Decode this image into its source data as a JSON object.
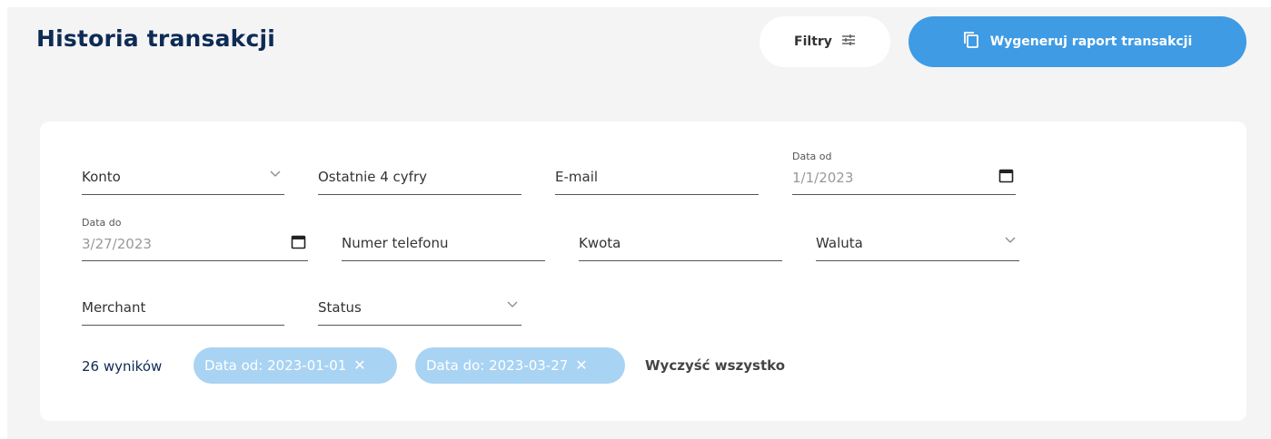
{
  "header": {
    "title": "Historia transakcji",
    "filters_label": "Filtry",
    "report_label": "Wygeneruj raport transakcji"
  },
  "filters": {
    "konto": {
      "label": "Konto"
    },
    "last4": {
      "label": "Ostatnie 4 cyfry"
    },
    "email": {
      "label": "E-mail"
    },
    "date_from": {
      "label": "Data od",
      "value": "1/1/2023"
    },
    "date_to": {
      "label": "Data do",
      "value": "3/27/2023"
    },
    "phone": {
      "label": "Numer telefonu"
    },
    "amount": {
      "label": "Kwota"
    },
    "currency": {
      "label": "Waluta"
    },
    "merchant": {
      "label": "Merchant"
    },
    "status": {
      "label": "Status"
    }
  },
  "summary": {
    "results": "26 wyników",
    "chips": [
      {
        "label": "Data od: 2023-01-01"
      },
      {
        "label": "Data do: 2023-03-27"
      }
    ],
    "clear_all": "Wyczyść wszystko"
  },
  "colors": {
    "accent": "#3f9be4",
    "chip": "#a9d3f3",
    "title": "#0d2b55"
  },
  "icons": {
    "filters": "sliders-icon",
    "report": "copy-document-icon",
    "dropdown": "chevron-down-icon",
    "calendar": "calendar-icon",
    "chip_remove": "close-icon"
  }
}
